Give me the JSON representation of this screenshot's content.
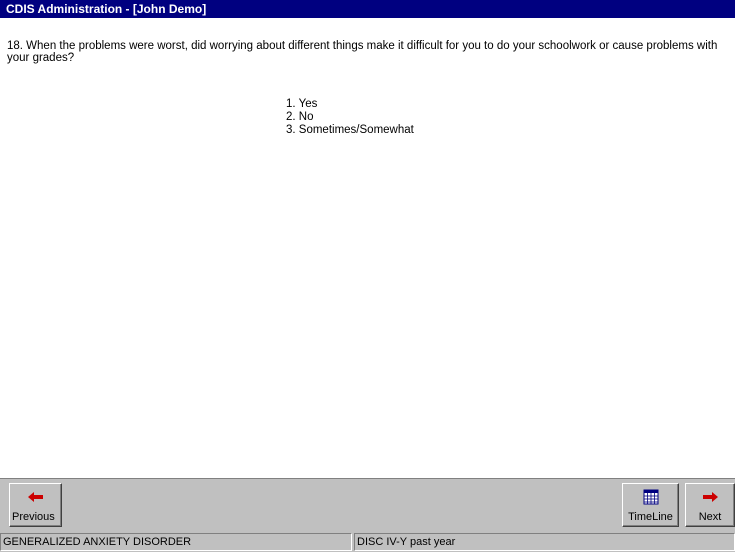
{
  "window": {
    "title": "CDIS Administration - [John Demo]"
  },
  "question": {
    "text": "18. When the problems were worst, did worrying about different things make it difficult for you to do your schoolwork or cause problems with your grades?",
    "options": [
      "1. Yes",
      "2. No",
      "3. Sometimes/Somewhat"
    ]
  },
  "toolbar": {
    "previous_label": "Previous",
    "previous_icon": "red-left-arrow-icon",
    "timeline_label": "TimeLine",
    "timeline_icon": "calendar-icon",
    "next_label": "Next",
    "next_icon": "red-right-arrow-icon"
  },
  "status": {
    "module": "GENERALIZED ANXIETY DISORDER",
    "instrument": "DISC IV-Y past year"
  },
  "colors": {
    "titlebar": "#000080",
    "face": "#c0c0c0",
    "arrow": "#cc0000"
  }
}
